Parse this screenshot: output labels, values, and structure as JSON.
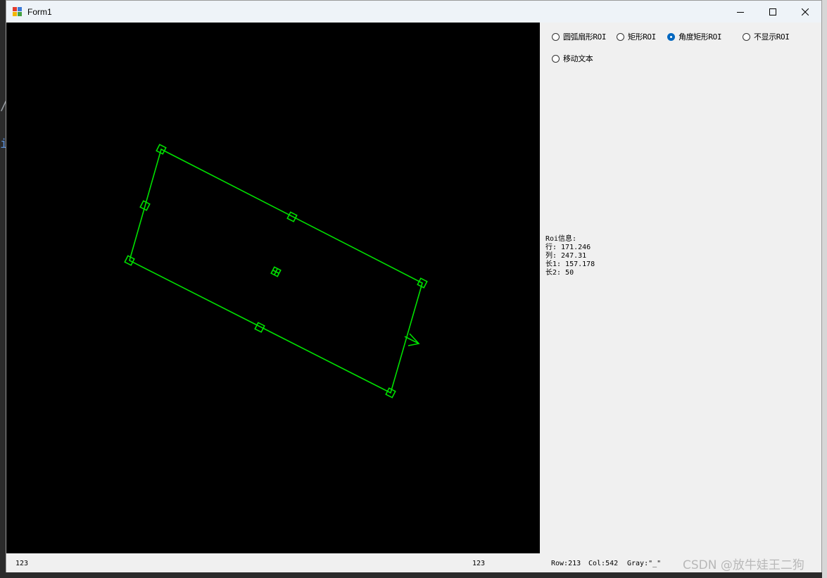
{
  "window": {
    "title": "Form1"
  },
  "title_controls": {
    "minimize_icon": "minimize-icon",
    "maximize_icon": "maximize-icon",
    "close_icon": "close-icon"
  },
  "roi_options": [
    {
      "label": "圆弧扇形ROI",
      "checked": false
    },
    {
      "label": "矩形ROI",
      "checked": false
    },
    {
      "label": "角度矩形ROI",
      "checked": true
    },
    {
      "label": "不显示ROI",
      "checked": false
    },
    {
      "label": "移动文本",
      "checked": false
    }
  ],
  "roi_info": {
    "heading": "Roi信息:",
    "row": "行: 171.246",
    "col": "列: 247.31",
    "len1": "长1: 157.178",
    "len2": "长2: 50"
  },
  "status": {
    "left_label": "123",
    "middle_label": "123",
    "row": "Row:213",
    "col": "Col:542",
    "gray": "Gray:\"_\""
  },
  "watermark": "CSDN @放牛娃王二狗",
  "colors": {
    "roi_stroke": "#00e000",
    "canvas_bg": "#000000",
    "radio_checked": "#0067c0"
  },
  "background_fragments": [
    "/",
    "i"
  ]
}
